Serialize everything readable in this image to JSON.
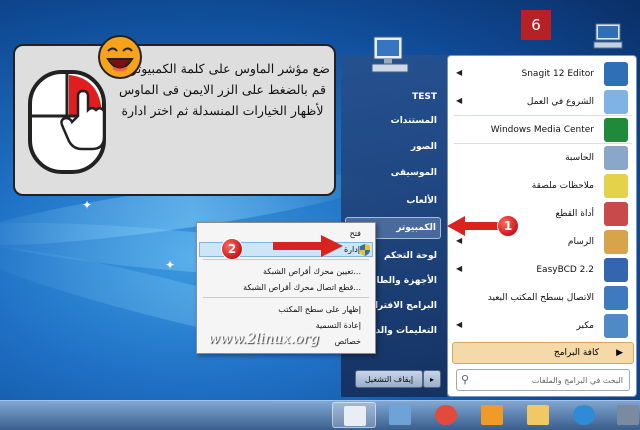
{
  "step_number": "6",
  "tip": {
    "text": "ضع مؤشر الماوس على كلمة الكمبيوتر ثم قم بالضغط على الزر الايمن فى الماوس لأظهار الخيارات المنسدلة ثم اختر ادارة"
  },
  "watermark": "www.2linux.org",
  "start_menu": {
    "programs": [
      {
        "label": "Snagit 12 Editor",
        "has_arrow": true,
        "icon": "snagit-icon",
        "color": "#2f6fb5"
      },
      {
        "label": "الشروع في العمل",
        "has_arrow": true,
        "icon": "getting-started-icon",
        "color": "#7fb2e5"
      },
      {
        "label": "Windows Media Center",
        "has_arrow": false,
        "icon": "media-center-icon",
        "color": "#1f8a3a"
      },
      {
        "label": "الحاسبة",
        "has_arrow": false,
        "icon": "calculator-icon",
        "color": "#8aa6c8"
      },
      {
        "label": "ملاحظات ملصقة",
        "has_arrow": false,
        "icon": "sticky-notes-icon",
        "color": "#e3d24a"
      },
      {
        "label": "أداة القطع",
        "has_arrow": false,
        "icon": "snipping-tool-icon",
        "color": "#c94a4a"
      },
      {
        "label": "الرسام",
        "has_arrow": true,
        "icon": "paint-icon",
        "color": "#d7a44a"
      },
      {
        "label": "EasyBCD 2.2",
        "has_arrow": true,
        "icon": "easybcd-icon",
        "color": "#3466b0"
      },
      {
        "label": "الاتصال بسطح المكتب البعيد",
        "has_arrow": false,
        "icon": "remote-desktop-icon",
        "color": "#3f7ac0"
      },
      {
        "label": "مكبر",
        "has_arrow": true,
        "icon": "magnifier-icon",
        "color": "#4f8ac6"
      }
    ],
    "all_programs": "كافة البرامج",
    "search_placeholder": "البحث في البرامج والملفات",
    "right_items": [
      {
        "label": "TEST",
        "highlight": false
      },
      {
        "label": "المستندات",
        "highlight": false
      },
      {
        "label": "الصور",
        "highlight": false
      },
      {
        "label": "الموسيقى",
        "highlight": false
      },
      {
        "label": "الألعاب",
        "highlight": false
      },
      {
        "label": "الكمبيوتر",
        "highlight": true
      },
      {
        "label": "لوحة التحكم",
        "highlight": false
      },
      {
        "label": "الأجهزة والطابعات",
        "highlight": false
      },
      {
        "label": "البرامج الافتراضية",
        "highlight": false
      },
      {
        "label": "التعليمات والدعم",
        "highlight": false
      }
    ],
    "shutdown_label": "إيقاف التشغيل"
  },
  "context_menu": {
    "items": [
      {
        "label": "فتح",
        "highlight": false,
        "shield": false
      },
      {
        "label": "إدارة",
        "highlight": true,
        "shield": true
      },
      {
        "label": "تعيين محرك أقراص الشبكة...",
        "highlight": false,
        "shield": false
      },
      {
        "label": "قطع اتصال محرك أقراص الشبكة...",
        "highlight": false,
        "shield": false
      },
      {
        "label": "إظهار على سطح المكتب",
        "highlight": false,
        "shield": false
      },
      {
        "label": "إعادة التسمية",
        "highlight": false,
        "shield": false
      },
      {
        "label": "خصائص",
        "highlight": false,
        "shield": false
      }
    ]
  },
  "badges": {
    "one": "1",
    "two": "2"
  },
  "colors": {
    "arrow_red": "#d8231f",
    "start_hover": "#f6d9a8"
  },
  "taskbar": {
    "buttons": [
      {
        "icon": "document-icon",
        "active": true
      },
      {
        "icon": "picture-viewer-icon",
        "active": false
      },
      {
        "icon": "chrome-icon",
        "active": false
      },
      {
        "icon": "media-player-icon",
        "active": false
      },
      {
        "icon": "file-explorer-icon",
        "active": false
      },
      {
        "icon": "internet-explorer-icon",
        "active": false
      },
      {
        "icon": "printer-icon",
        "active": false
      }
    ]
  }
}
